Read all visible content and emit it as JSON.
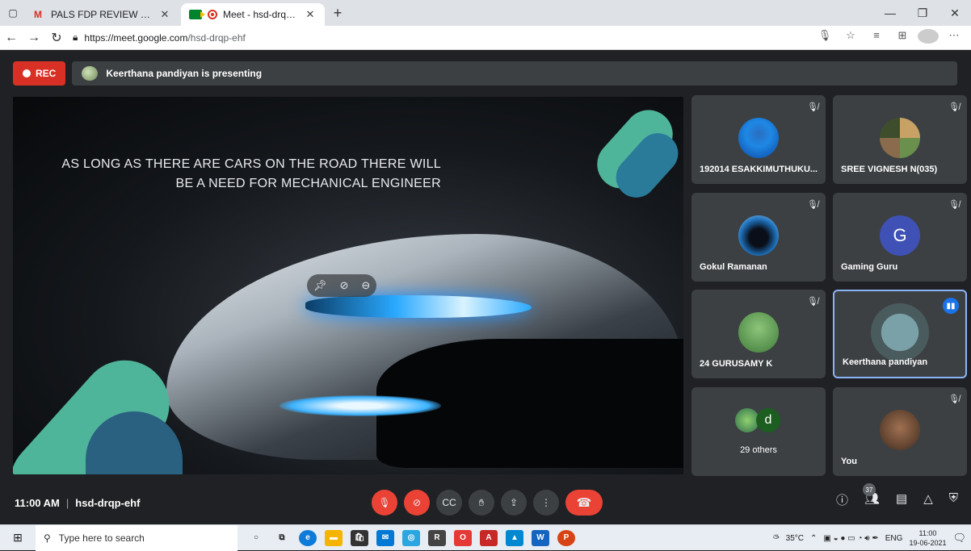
{
  "browser": {
    "tabs": [
      {
        "title": "PALS FDP REVIEW SESSION - Wi",
        "icon": "gmail-icon"
      },
      {
        "title": "Meet - hsd-drqp-ehf",
        "icon": "meet-icon"
      }
    ],
    "url_host": "https://meet.google.com",
    "url_path": "/hsd-drqp-ehf"
  },
  "meet": {
    "rec_label": "REC",
    "presenting_text": "Keerthana pandiyan is presenting",
    "slide_text": "AS LONG AS THERE ARE CARS ON THE ROAD THERE WILL BE A NEED FOR MECHANICAL ENGINEER",
    "participants": [
      {
        "name": "192014 ESAKKIMUTHUKU...",
        "muted": true
      },
      {
        "name": "SREE VIGNESH N(035)",
        "muted": true
      },
      {
        "name": "Gokul Ramanan",
        "muted": true
      },
      {
        "name": "Gaming Guru",
        "muted": true,
        "initial": "G"
      },
      {
        "name": "24 GURUSAMY K",
        "muted": true
      },
      {
        "name": "Keerthana pandiyan",
        "muted": false,
        "speaking": true
      },
      {
        "name": "29 others",
        "second_initial": "d"
      },
      {
        "name": "You",
        "muted": true
      }
    ],
    "time": "11:00 AM",
    "meeting_code": "hsd-drqp-ehf",
    "participant_count": "37",
    "accent": "#8ab4f8",
    "danger": "#ea4335"
  },
  "taskbar": {
    "search_placeholder": "Type here to search",
    "weather": "35°C",
    "lang": "ENG",
    "time": "11:00",
    "date": "19-06-2021"
  }
}
